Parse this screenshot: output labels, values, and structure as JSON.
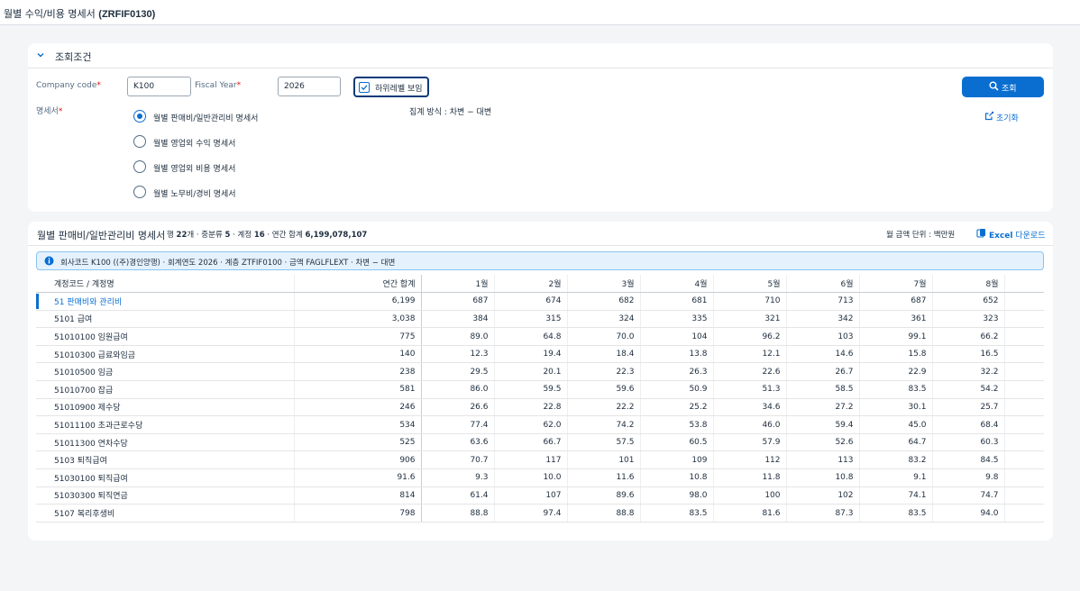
{
  "app": {
    "title_prefix": "월별 수익/비용 명세서",
    "title_code": "(ZRFIF0130)"
  },
  "filter": {
    "section_title": "조회조건",
    "company_code_label": "Company code",
    "company_code_value": "K100",
    "fiscal_year_label": "Fiscal Year",
    "fiscal_year_value": "2026",
    "sublevel_label": "하위레벨 보임",
    "statement_label": "명세서",
    "required_mark": "*",
    "options": [
      {
        "label": "월별 판매비/일반관리비 명세서",
        "selected": true
      },
      {
        "label": "월별 영업외 수익 명세서",
        "selected": false
      },
      {
        "label": "월별 영업외 비용 명세서",
        "selected": false
      },
      {
        "label": "월별 노무비/경비 명세서",
        "selected": false
      }
    ],
    "aggregation_text": "집계 방식 : 차변 − 대변",
    "search_button": "조회",
    "reset_button": "초기화"
  },
  "result": {
    "title": "월별 판매비/일반관리비 명세서",
    "meta": {
      "rows_prefix": "행",
      "rows": "22",
      "rows_suffix": "개 · 중분류",
      "mid": "5",
      "mid_suffix": "· 계정",
      "accounts": "16",
      "accounts_suffix": "· 연간 합계",
      "total": "6,199,078,107"
    },
    "unit_label": "월 금액 단위 : 백만원",
    "excel_bold": "Excel",
    "excel_rest": "다운로드",
    "info_text": "회사코드 K100 ((주)경인양행) · 회계연도 2026 · 계층 ZTFIF0100 · 금액 FAGLFLEXT · 차변 − 대변",
    "columns": [
      "계정코드 / 계정명",
      "연간 합계",
      "1월",
      "2월",
      "3월",
      "4월",
      "5월",
      "6월",
      "7월",
      "8월"
    ],
    "rows": [
      {
        "name": "51 판매비와 관리비",
        "values": [
          "6,199",
          "687",
          "674",
          "682",
          "681",
          "710",
          "713",
          "687",
          "652"
        ],
        "link": true,
        "selected": true
      },
      {
        "name": "5101 급여",
        "values": [
          "3,038",
          "384",
          "315",
          "324",
          "335",
          "321",
          "342",
          "361",
          "323"
        ]
      },
      {
        "name": "51010100 임원급여",
        "values": [
          "775",
          "89.0",
          "64.8",
          "70.0",
          "104",
          "96.2",
          "103",
          "99.1",
          "66.2"
        ]
      },
      {
        "name": "51010300 급료와임금",
        "values": [
          "140",
          "12.3",
          "19.4",
          "18.4",
          "13.8",
          "12.1",
          "14.6",
          "15.8",
          "16.5"
        ]
      },
      {
        "name": "51010500 임금",
        "values": [
          "238",
          "29.5",
          "20.1",
          "22.3",
          "26.3",
          "22.6",
          "26.7",
          "22.9",
          "32.2"
        ]
      },
      {
        "name": "51010700 잡급",
        "values": [
          "581",
          "86.0",
          "59.5",
          "59.6",
          "50.9",
          "51.3",
          "58.5",
          "83.5",
          "54.2"
        ]
      },
      {
        "name": "51010900 제수당",
        "values": [
          "246",
          "26.6",
          "22.8",
          "22.2",
          "25.2",
          "34.6",
          "27.2",
          "30.1",
          "25.7"
        ]
      },
      {
        "name": "51011100 초과근로수당",
        "values": [
          "534",
          "77.4",
          "62.0",
          "74.2",
          "53.8",
          "46.0",
          "59.4",
          "45.0",
          "68.4"
        ]
      },
      {
        "name": "51011300 연차수당",
        "values": [
          "525",
          "63.6",
          "66.7",
          "57.5",
          "60.5",
          "57.9",
          "52.6",
          "64.7",
          "60.3"
        ]
      },
      {
        "name": "5103 퇴직급여",
        "values": [
          "906",
          "70.7",
          "117",
          "101",
          "109",
          "112",
          "113",
          "83.2",
          "84.5"
        ]
      },
      {
        "name": "51030100 퇴직급여",
        "values": [
          "91.6",
          "9.3",
          "10.0",
          "11.6",
          "10.8",
          "11.8",
          "10.8",
          "9.1",
          "9.8"
        ]
      },
      {
        "name": "51030300 퇴직연금",
        "values": [
          "814",
          "61.4",
          "107",
          "89.6",
          "98.0",
          "100",
          "102",
          "74.1",
          "74.7"
        ]
      },
      {
        "name": "5107 복리후생비",
        "values": [
          "798",
          "88.8",
          "97.4",
          "88.8",
          "83.5",
          "81.6",
          "87.3",
          "83.5",
          "94.0"
        ]
      }
    ]
  },
  "colors": {
    "accent": "#0a6ed1",
    "required": "#dd1111",
    "info_bg": "#e5f2fd"
  }
}
